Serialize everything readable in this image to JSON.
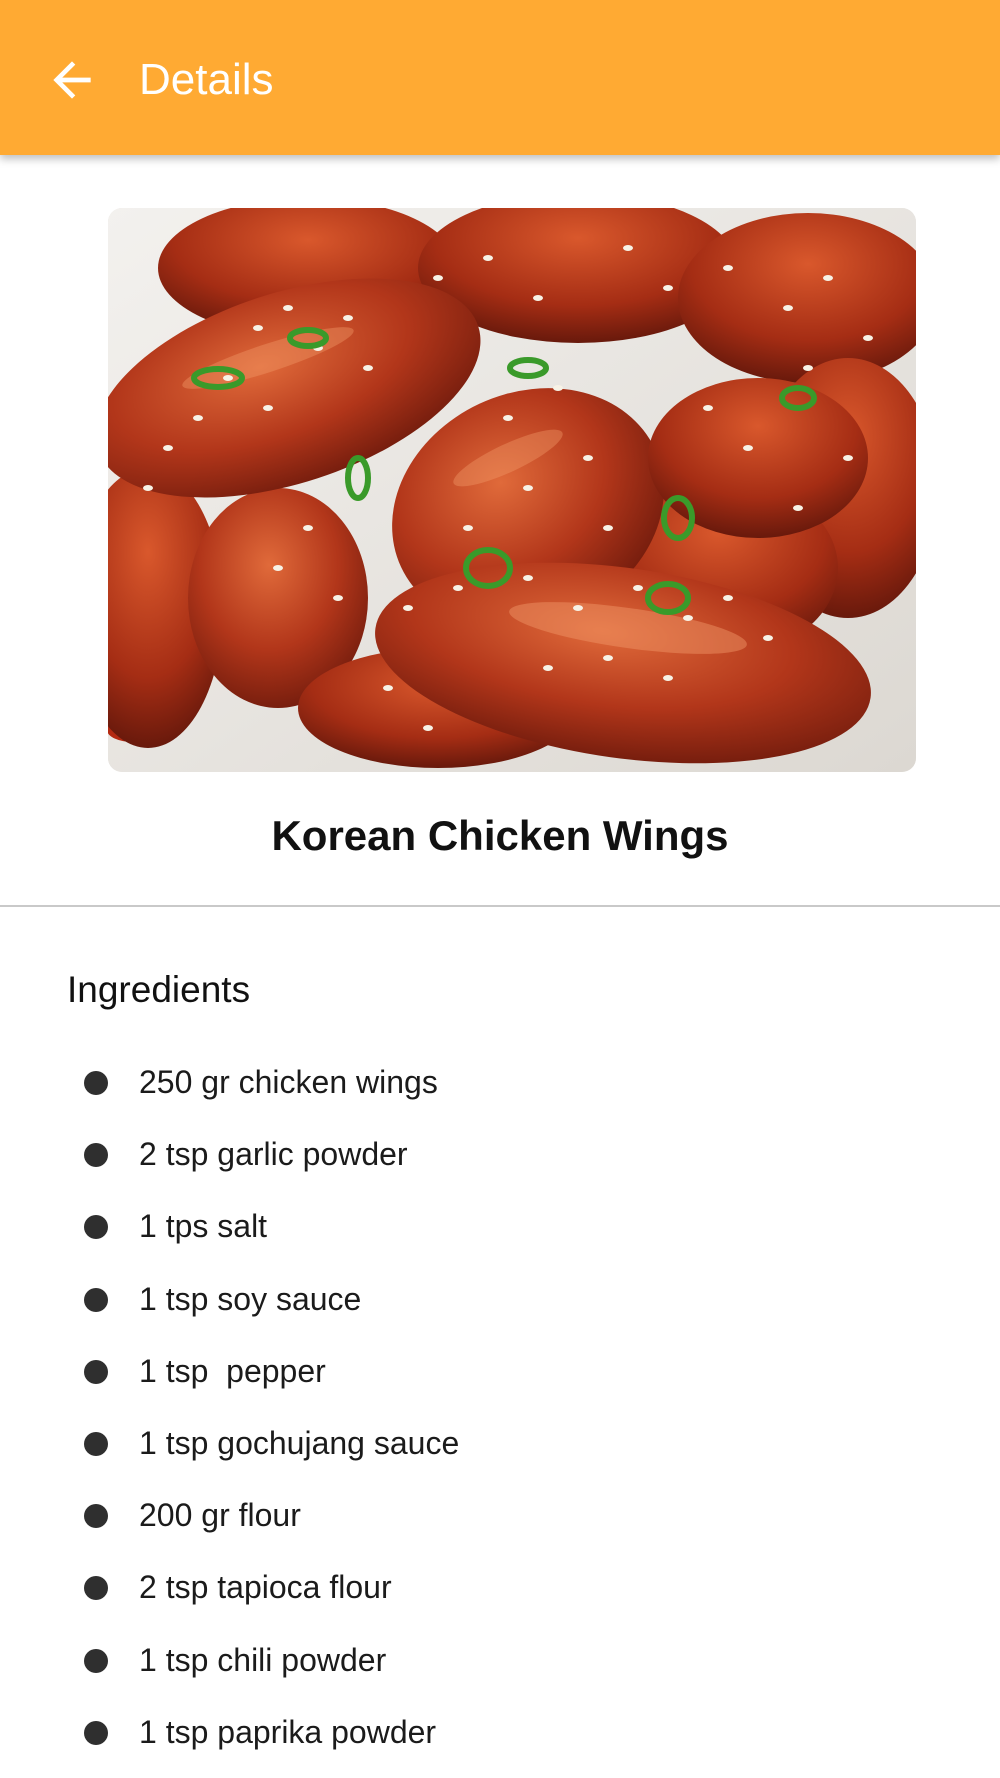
{
  "app_bar": {
    "title": "Details",
    "back_icon": "arrow-left-icon",
    "color": "#FFAA33"
  },
  "hero_image": {
    "subject": "glazed chicken wings with sesame seeds and green onion"
  },
  "recipe": {
    "title": "Korean Chicken Wings"
  },
  "ingredients_section": {
    "title": "Ingredients",
    "items": [
      "250 gr chicken wings",
      "2 tsp garlic powder",
      "1 tps salt",
      "1 tsp soy sauce",
      "1 tsp  pepper",
      "1 tsp gochujang sauce",
      "200 gr flour",
      "2 tsp tapioca flour",
      "1 tsp chili powder",
      "1 tsp paprika powder"
    ]
  }
}
